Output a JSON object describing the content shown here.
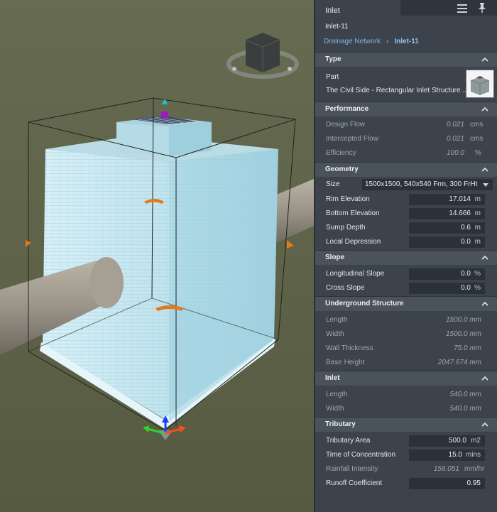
{
  "panel": {
    "tab_label": "Inlet",
    "title": "Inlet-11",
    "breadcrumb": {
      "parent": "Drainage Network",
      "separator": "›",
      "current": "Inlet-11"
    },
    "type": {
      "header": "Type",
      "part_label": "Part",
      "part_value": "The Civil Side - Rectangular Inlet Structure ..."
    },
    "performance": {
      "header": "Performance",
      "design_flow": {
        "label": "Design Flow",
        "value": "0.021",
        "unit": "cms"
      },
      "intercepted_flow": {
        "label": "Intercepted Flow",
        "value": "0.021",
        "unit": "cms"
      },
      "efficiency": {
        "label": "Efficiency",
        "value": "100.0",
        "unit": "%"
      }
    },
    "geometry": {
      "header": "Geometry",
      "size": {
        "label": "Size",
        "value": "1500x1500, 540x540 Frm, 300 FrHt"
      },
      "rim_elevation": {
        "label": "Rim Elevation",
        "value": "17.014",
        "unit": "m"
      },
      "bottom_elevation": {
        "label": "Bottom Elevation",
        "value": "14.666",
        "unit": "m"
      },
      "sump_depth": {
        "label": "Sump Depth",
        "value": "0.6",
        "unit": "m"
      },
      "local_depression": {
        "label": "Local Depression",
        "value": "0.0",
        "unit": "m"
      }
    },
    "slope": {
      "header": "Slope",
      "longitudinal": {
        "label": "Longitudinal Slope",
        "value": "0.0",
        "unit": "%"
      },
      "cross": {
        "label": "Cross Slope",
        "value": "0.0",
        "unit": "%"
      }
    },
    "underground": {
      "header": "Underground Structure",
      "length": {
        "label": "Length",
        "value": "1500.0 mm"
      },
      "width": {
        "label": "Width",
        "value": "1500.0 mm"
      },
      "wall_thickness": {
        "label": "Wall Thickness",
        "value": "75.0 mm"
      },
      "base_height": {
        "label": "Base Height",
        "value": "2047.674 mm"
      }
    },
    "inlet": {
      "header": "Inlet",
      "length": {
        "label": "Length",
        "value": "540.0 mm"
      },
      "width": {
        "label": "Width",
        "value": "540.0 mm"
      }
    },
    "tributary": {
      "header": "Tributary",
      "area": {
        "label": "Tributary Area",
        "value": "500.0",
        "unit": "m2"
      },
      "toc": {
        "label": "Time of Concentration",
        "value": "15.0",
        "unit": "mins"
      },
      "rainfall": {
        "label": "Rainfall Intensity",
        "value": "156.051",
        "unit": "mm/hr"
      },
      "runoff": {
        "label": "Runoff Coefficient",
        "value": "0.95"
      }
    }
  },
  "colors": {
    "panel_bg": "#3c434d",
    "section_bg": "#4a525c",
    "input_bg": "#2b3138",
    "link": "#7fb6e0",
    "viewport_bg": "#5f644a"
  },
  "icons": [
    "menu-icon",
    "pin-icon",
    "chevron-up-icon",
    "dropdown-arrow-icon",
    "view-cube-icon",
    "gizmo-axes-icon",
    "rotate-handle-icon"
  ]
}
